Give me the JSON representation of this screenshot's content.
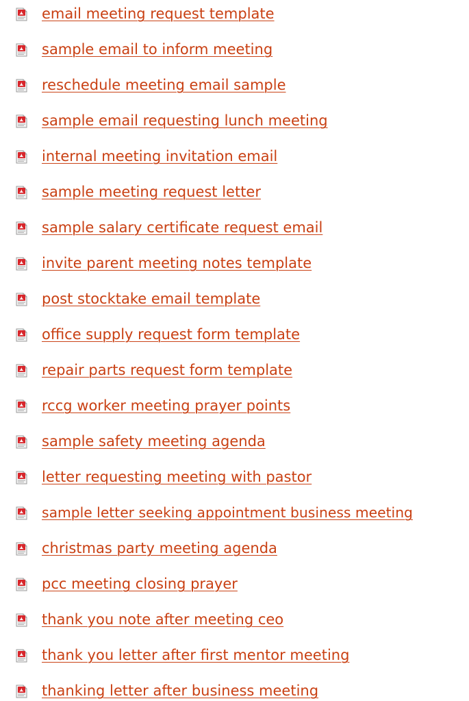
{
  "accent_color": "#c94013",
  "icon": "pdf-file-icon",
  "links": [
    "email meeting request template",
    "sample email to inform meeting",
    "reschedule meeting email sample",
    "sample email requesting lunch meeting",
    "internal meeting invitation email",
    "sample meeting request letter",
    "sample salary certificate request email",
    "invite parent meeting notes template",
    "post stocktake email template",
    "office supply request form template",
    "repair parts request form template",
    "rccg worker meeting prayer points",
    "sample safety meeting agenda",
    "letter requesting meeting with pastor",
    "sample letter seeking appointment business meeting",
    "christmas party meeting agenda",
    "pcc meeting closing prayer",
    "thank you note after meeting ceo",
    "thank you letter after first mentor meeting",
    "thanking letter after business meeting"
  ]
}
